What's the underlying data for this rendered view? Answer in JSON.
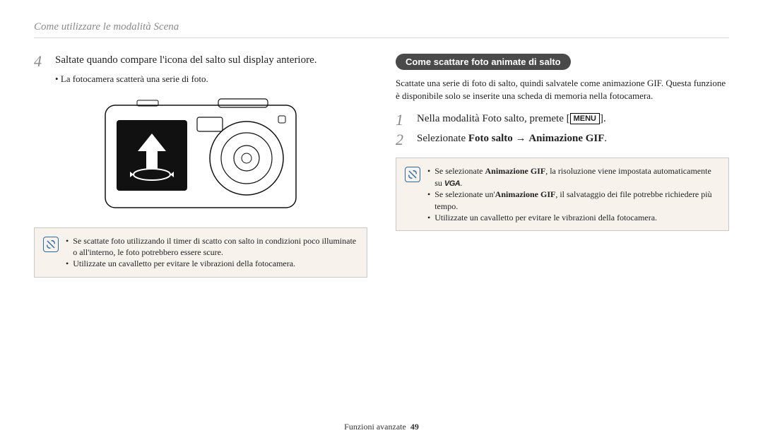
{
  "header": {
    "title": "Come utilizzare le modalità Scena"
  },
  "left": {
    "step4_num": "4",
    "step4_text": "Saltate quando compare l'icona del salto sul display anteriore.",
    "step4_sub": "La fotocamera scatterà una serie di foto.",
    "note": {
      "items": [
        "Se scattate foto utilizzando il timer di scatto con salto in condizioni poco illuminate o all'interno, le foto potrebbero essere scure.",
        "Utilizzate un cavalletto per evitare le vibrazioni della fotocamera."
      ]
    }
  },
  "right": {
    "pill": "Come scattare foto animate di salto",
    "intro": "Scattate una serie di foto di salto, quindi salvatele come animazione GIF. Questa funzione è disponibile solo se inserite una scheda di memoria nella fotocamera.",
    "step1_num": "1",
    "step1_pre": "Nella modalità Foto salto, premete [",
    "step1_menu": "MENU",
    "step1_post": "].",
    "step2_num": "2",
    "step2_pre": "Selezionate ",
    "step2_bold1": "Foto salto",
    "step2_arrow": " → ",
    "step2_bold2": "Animazione GIF",
    "step2_post": ".",
    "note": {
      "items_pre": [
        "Se selezionate ",
        "Se selezionate un'",
        "Utilizzate un cavalletto per evitare le vibrazioni della fotocamera."
      ],
      "bold": [
        "Animazione GIF",
        "Animazione GIF"
      ],
      "items_mid": [
        ", la risoluzione viene impostata automaticamente su ",
        ", il salvataggio dei file potrebbe richiedere più tempo."
      ],
      "vga": "VGA",
      "items_post": [
        ".",
        "",
        ""
      ]
    }
  },
  "footer": {
    "section": "Funzioni avanzate",
    "page": "49"
  }
}
